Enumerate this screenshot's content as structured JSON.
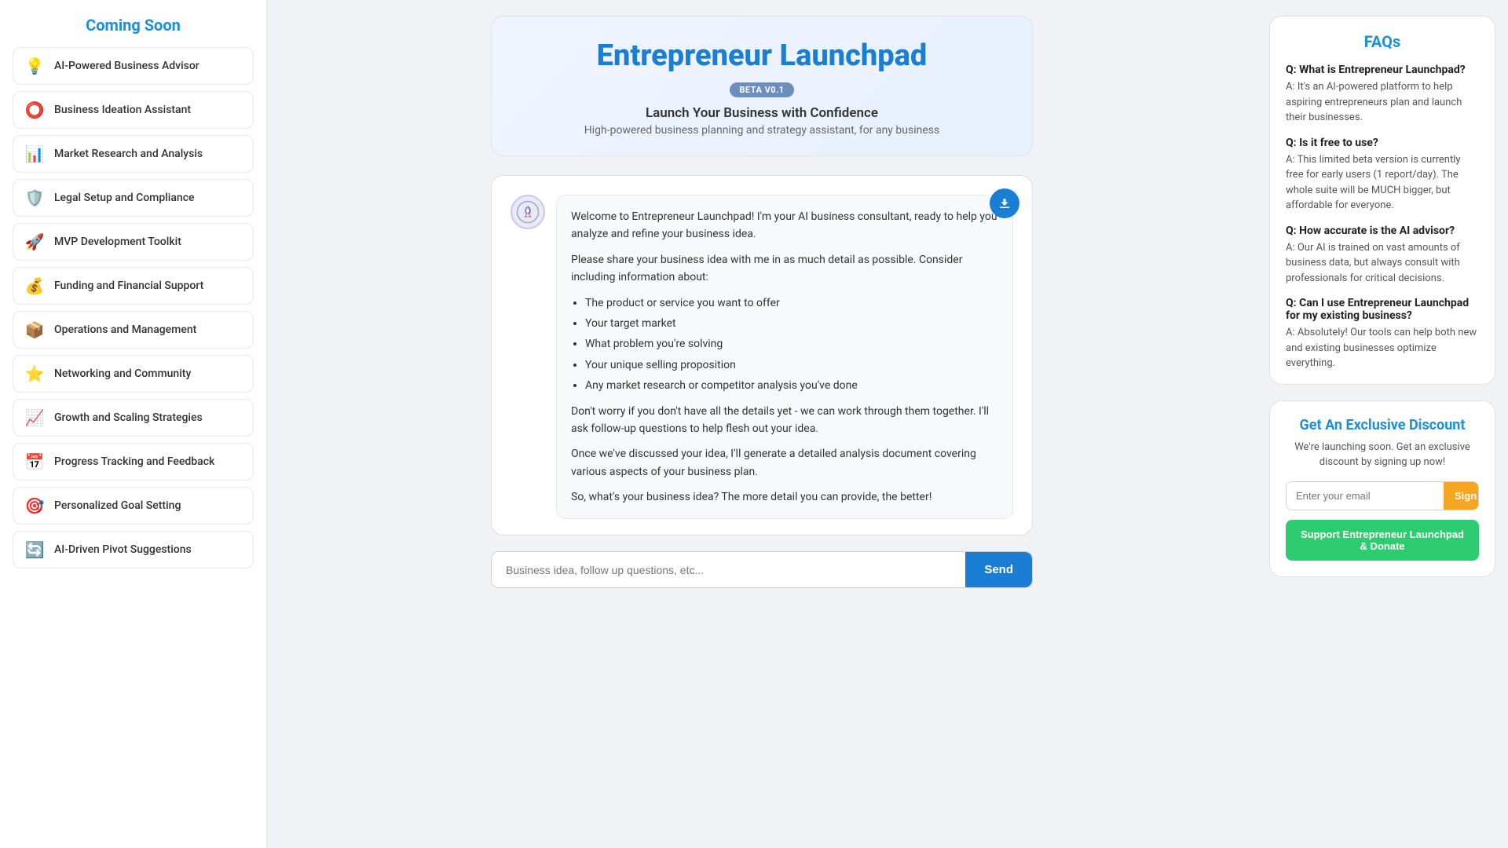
{
  "sidebar": {
    "title": "Coming Soon",
    "items": [
      {
        "id": "ai-business-advisor",
        "icon": "💡",
        "label": "AI-Powered Business Advisor"
      },
      {
        "id": "business-ideation",
        "icon": "⭕",
        "label": "Business Ideation Assistant"
      },
      {
        "id": "market-research",
        "icon": "📊",
        "label": "Market Research and Analysis"
      },
      {
        "id": "legal-setup",
        "icon": "🛡️",
        "label": "Legal Setup and Compliance"
      },
      {
        "id": "mvp-development",
        "icon": "🚀",
        "label": "MVP Development Toolkit"
      },
      {
        "id": "funding-financial",
        "icon": "💰",
        "label": "Funding and Financial Support"
      },
      {
        "id": "operations-management",
        "icon": "📦",
        "label": "Operations and Management"
      },
      {
        "id": "networking-community",
        "icon": "⭐",
        "label": "Networking and Community"
      },
      {
        "id": "growth-scaling",
        "icon": "📈",
        "label": "Growth and Scaling Strategies"
      },
      {
        "id": "progress-tracking",
        "icon": "📅",
        "label": "Progress Tracking and Feedback"
      },
      {
        "id": "personalized-goal",
        "icon": "🎯",
        "label": "Personalized Goal Setting"
      },
      {
        "id": "ai-pivot",
        "icon": "🔄",
        "label": "AI-Driven Pivot Suggestions"
      }
    ]
  },
  "header": {
    "title": "Entrepreneur Launchpad",
    "badge": "BETA V0.1",
    "subtitle": "Launch Your Business with Confidence",
    "description": "High-powered business planning and strategy assistant, for any business"
  },
  "chat": {
    "welcome_message_p1": "Welcome to Entrepreneur Launchpad! I'm your AI business consultant, ready to help you analyze and refine your business idea.",
    "welcome_message_p2": "Please share your business idea with me in as much detail as possible. Consider including information about:",
    "bullet_items": [
      "The product or service you want to offer",
      "Your target market",
      "What problem you're solving",
      "Your unique selling proposition",
      "Any market research or competitor analysis you've done"
    ],
    "welcome_message_p3": "Don't worry if you don't have all the details yet - we can work through them together. I'll ask follow-up questions to help flesh out your idea.",
    "welcome_message_p4": "Once we've discussed your idea, I'll generate a detailed analysis document covering various aspects of your business plan.",
    "welcome_message_p5": "So, what's your business idea? The more detail you can provide, the better!"
  },
  "input": {
    "placeholder": "Business idea, follow up questions, etc...",
    "send_label": "Send"
  },
  "faqs": {
    "title": "FAQs",
    "items": [
      {
        "question": "Q: What is Entrepreneur Launchpad?",
        "answer": "A: It's an AI-powered platform to help aspiring entrepreneurs plan and launch their businesses."
      },
      {
        "question": "Q: Is it free to use?",
        "answer": "A: This limited beta version is currently free for early users (1 report/day). The whole suite will be MUCH bigger, but affordable for everyone."
      },
      {
        "question": "Q: How accurate is the AI advisor?",
        "answer": "A: Our AI is trained on vast amounts of business data, but always consult with professionals for critical decisions."
      },
      {
        "question": "Q: Can I use Entrepreneur Launchpad for my existing business?",
        "answer": "A: Absolutely! Our tools can help both new and existing businesses optimize everything."
      }
    ]
  },
  "discount": {
    "title": "Get An Exclusive Discount",
    "description": "We're launching soon. Get an exclusive discount by signing up now!",
    "email_placeholder": "Enter your email",
    "signup_label": "Sign Up",
    "donate_label": "Support Entrepreneur Launchpad & Donate"
  }
}
